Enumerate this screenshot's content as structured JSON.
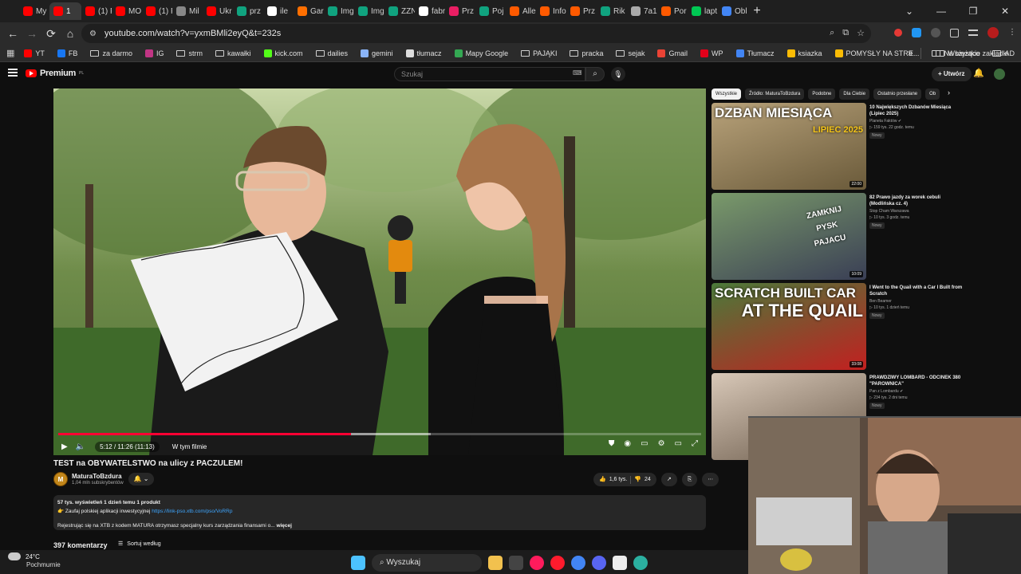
{
  "browser": {
    "tabs": [
      {
        "label": "My",
        "color": "#ff0000"
      },
      {
        "label": "1",
        "color": "#ff0000",
        "active": true
      },
      {
        "label": "(1) F",
        "color": "#ff0000"
      },
      {
        "label": "MO",
        "color": "#ff0000"
      },
      {
        "label": "(1) F",
        "color": "#ff0000"
      },
      {
        "label": "Mil",
        "color": "#888888"
      },
      {
        "label": "Ukr",
        "color": "#ff0000"
      },
      {
        "label": "prz",
        "color": "#10a37f"
      },
      {
        "label": "ile",
        "color": "#ffffff"
      },
      {
        "label": "Gar",
        "color": "#ff6f00"
      },
      {
        "label": "Img",
        "color": "#10a37f"
      },
      {
        "label": "Img",
        "color": "#10a37f"
      },
      {
        "label": "ZZN",
        "color": "#10a37f"
      },
      {
        "label": "fabr",
        "color": "#ffffff"
      },
      {
        "label": "Prz",
        "color": "#e91e63"
      },
      {
        "label": "Poj",
        "color": "#10a37f"
      },
      {
        "label": "Alle",
        "color": "#ff5a00"
      },
      {
        "label": "Info",
        "color": "#ff5a00"
      },
      {
        "label": "Prz",
        "color": "#ff5a00"
      },
      {
        "label": "Rik",
        "color": "#10a37f"
      },
      {
        "label": "7a1",
        "color": "#aaaaaa"
      },
      {
        "label": "Por",
        "color": "#ff5a00"
      },
      {
        "label": "lapt",
        "color": "#00c853"
      },
      {
        "label": "Obl",
        "color": "#4285f4"
      }
    ],
    "new_tab": "+",
    "window_controls": [
      "⌄",
      "—",
      "❐",
      "✕"
    ],
    "url": "youtube.com/watch?v=yxmBMli2eyQ&t=232s",
    "nav": {
      "back": "←",
      "forward": "→",
      "reload": "⟳",
      "home": "⌂"
    },
    "bookmarks": [
      {
        "label": "YT",
        "color": "#ff0000"
      },
      {
        "label": "FB",
        "color": "#1877f2"
      },
      {
        "label": "za darmo",
        "folder": true
      },
      {
        "label": "IG",
        "color": "#c13584"
      },
      {
        "label": "strm",
        "folder": true
      },
      {
        "label": "kawałki",
        "folder": true
      },
      {
        "label": "kick.com",
        "color": "#53fc18"
      },
      {
        "label": "dailies",
        "folder": true
      },
      {
        "label": "gemini",
        "color": "#8ab4f8"
      },
      {
        "label": "tłumacz",
        "color": "#dddddd"
      },
      {
        "label": "Mapy Google",
        "color": "#34a853"
      },
      {
        "label": "PAJĄKI",
        "folder": true
      },
      {
        "label": "pracka",
        "folder": true
      },
      {
        "label": "sejak",
        "folder": true
      },
      {
        "label": "Gmail",
        "color": "#ea4335"
      },
      {
        "label": "WP",
        "color": "#e2001a"
      },
      {
        "label": "Tłumacz",
        "color": "#4285f4"
      },
      {
        "label": "ksiazka",
        "color": "#fbbc05"
      },
      {
        "label": "POMYSŁY NA STRE...",
        "color": "#fbbc05"
      },
      {
        "label": "Na bieżąco",
        "folder": true
      },
      {
        "label": "AD",
        "folder": true
      }
    ],
    "bookmarks_more": "»",
    "all_bookmarks": "Wszystkie zakładki"
  },
  "youtube": {
    "logo": "Premium",
    "logo_sup": "PL",
    "search_placeholder": "Szukaj",
    "create_label": "+ Utwórz",
    "video": {
      "title": "TEST na OBYWATELSTWO na ulicy z PACZULEM!",
      "time": "5:12 / 11:26 (11:13)",
      "chapter": "W tym filmie",
      "progress_played": 0.455,
      "progress_loaded": 0.58,
      "channel": "MaturaToBzdura",
      "subs": "1,04 mln subskrybentów",
      "channel_initial": "M",
      "likes": "1,6 tys.",
      "dislikes": "24",
      "desc_line1": "57 tys. wyświetleń  1 dzień temu  1 produkt",
      "desc_line2_pre": "👉 Zaufaj polskiej aplikacji inwestycyjnej ",
      "desc_link": "https://link-pso.xtb.com/pso/VoRRp",
      "desc_line3": "Rejestrując się na XTB z kodem MATURA otrzymasz specjalny kurs zarządzania finansami o...",
      "desc_more": "więcej",
      "comments_count": "397 komentarzy",
      "sort_label": "Sortuj według"
    },
    "chips": [
      "Wszystkie",
      "Źródło: MaturaToBzdura",
      "Podobne",
      "Dla Ciebie",
      "Ostatnio przesłane",
      "Ob"
    ],
    "recommendations": [
      {
        "title": "10 Największych Dzbanów Miesiąca (Lipiec 2025)",
        "channel": "Planeta Faktów ✔",
        "meta": "▷ 159 tys.  22 godz. temu",
        "badge": "Nowy",
        "duration": "22:00",
        "thumb_text1": "DZBAN MIESIĄCA",
        "thumb_text2": "LIPIEC 2025",
        "colors": [
          "#b8a27a",
          "#6a5a3a"
        ]
      },
      {
        "title": "82 Prawo jazdy za worek cebuli (Modlińska cz. 4)",
        "channel": "Stop Cham Warszawa",
        "meta": "▷ 10 tys.  3 godz. temu",
        "badge": "Nowy",
        "duration": "10:09",
        "thumb_text1": "ZAMKNIJ PYSK PAJACU",
        "thumb_text2": "",
        "colors": [
          "#7a9a6a",
          "#3a3f55"
        ]
      },
      {
        "title": "I Went to the Quail with a Car I Built from Scratch",
        "channel": "Ben Beamer",
        "meta": "▷ 10 tys.  1 dzień temu",
        "badge": "Nowy",
        "duration": "33:08",
        "thumb_text1": "SCRATCH BUILT CAR",
        "thumb_text2": "AT THE QUAIL",
        "colors": [
          "#4a7a3a",
          "#c22020"
        ]
      },
      {
        "title": "PRAWDZIWY LOMBARD - ODCINEK 380 \"PAROWNICA\"",
        "channel": "Pan z Lombardu ✔",
        "meta": "▷ 234 tys.  2 dni temu",
        "badge": "Nowy",
        "duration": "",
        "thumb_text1": "",
        "thumb_text2": "",
        "colors": [
          "#d8c8b8",
          "#6a5a4a"
        ]
      }
    ]
  },
  "taskbar": {
    "temp": "24°C",
    "condition": "Pochmurnie",
    "search_label": "Wyszukaj",
    "apps": [
      {
        "name": "windows",
        "color": "#4cc2ff"
      },
      {
        "name": "explorer",
        "color": "#f2c14e"
      },
      {
        "name": "obs",
        "color": "#444444"
      },
      {
        "name": "opera-gx",
        "color": "#ff1b5c"
      },
      {
        "name": "opera",
        "color": "#ff1b2d"
      },
      {
        "name": "chrome",
        "color": "#4285f4"
      },
      {
        "name": "discord",
        "color": "#5865f2"
      },
      {
        "name": "app-white",
        "color": "#eeeeee"
      },
      {
        "name": "app-earth",
        "color": "#2bb0a0"
      }
    ]
  }
}
